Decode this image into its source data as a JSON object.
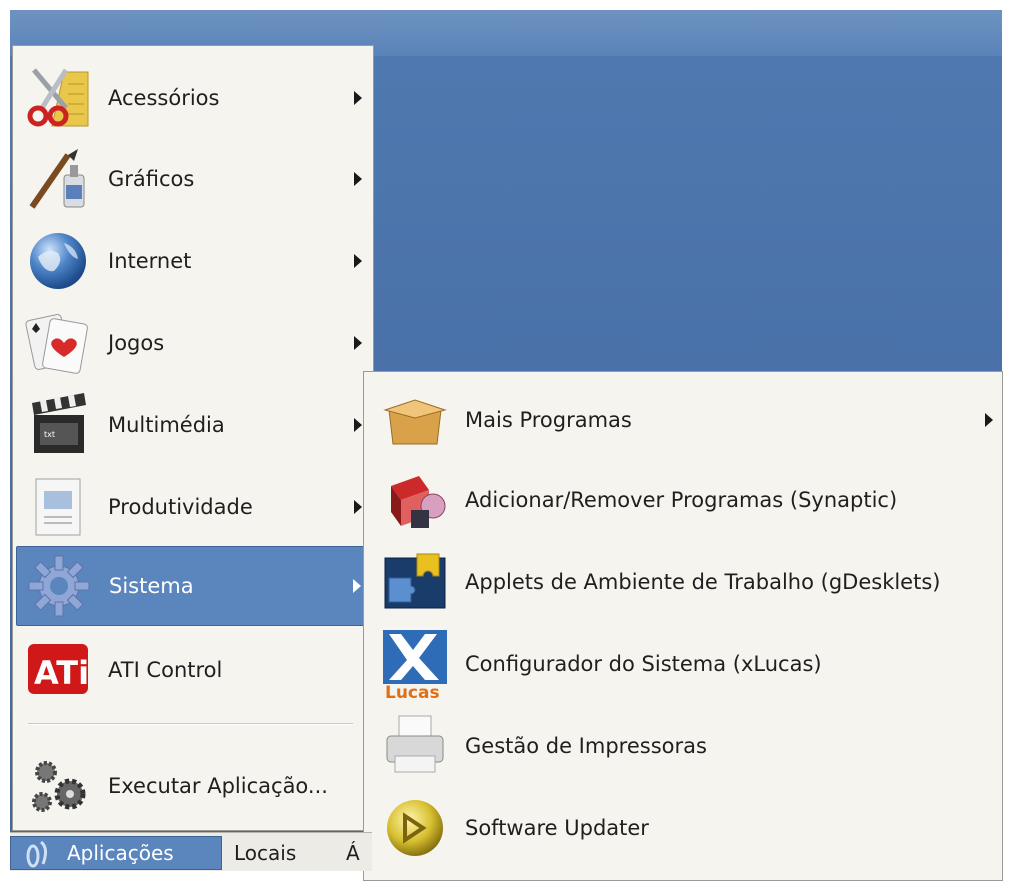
{
  "menu": {
    "items": [
      {
        "label": "Acessórios",
        "icon": "accessories-icon",
        "submenu": true
      },
      {
        "label": "Gráficos",
        "icon": "graphics-icon",
        "submenu": true
      },
      {
        "label": "Internet",
        "icon": "internet-globe-icon",
        "submenu": true
      },
      {
        "label": "Jogos",
        "icon": "playing-cards-icon",
        "submenu": true
      },
      {
        "label": "Multimédia",
        "icon": "clapperboard-icon",
        "submenu": true
      },
      {
        "label": "Produtividade",
        "icon": "document-icon",
        "submenu": true
      },
      {
        "label": "Sistema",
        "icon": "gear-icon",
        "submenu": true,
        "active": true
      },
      {
        "label": "ATI Control",
        "icon": "ati-logo-icon",
        "submenu": false
      }
    ],
    "run_application": {
      "label": "Executar Aplicação...",
      "icon": "gears-icon"
    }
  },
  "submenu": {
    "items": [
      {
        "label": "Mais Programas",
        "icon": "package-box-icon",
        "submenu": true
      },
      {
        "label": "Adicionar/Remover Programas (Synaptic)",
        "icon": "synaptic-package-icon",
        "submenu": false
      },
      {
        "label": "Applets de Ambiente de Trabalho (gDesklets)",
        "icon": "puzzle-piece-icon",
        "submenu": false
      },
      {
        "label": "Configurador do Sistema (xLucas)",
        "icon": "xlucas-logo-icon",
        "submenu": false,
        "logo_text": "Lucas"
      },
      {
        "label": "Gestão de Impressoras",
        "icon": "printer-icon",
        "submenu": false
      },
      {
        "label": "Software Updater",
        "icon": "updater-icon",
        "submenu": false
      }
    ]
  },
  "panel": {
    "applications": "Aplicações",
    "places": "Locais",
    "system_truncated": "Á"
  },
  "colors": {
    "desktop": "#4a72a9",
    "menu_bg": "#f5f4ef",
    "selection": "#5b85bd"
  }
}
